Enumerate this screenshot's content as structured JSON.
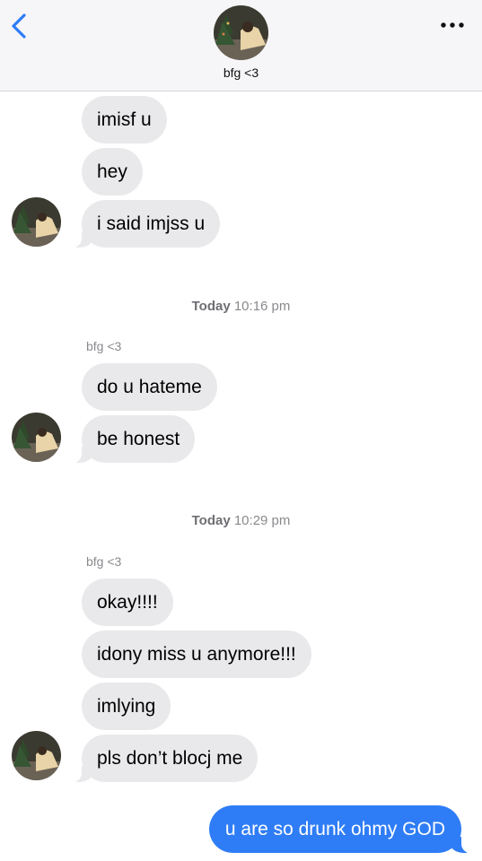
{
  "header": {
    "contact_name": "bfg <3",
    "back_icon": "chevron-left-icon",
    "more_icon": "ellipsis-icon",
    "accent": "#2f7df6"
  },
  "messages": {
    "group1": [
      "imisf u",
      "hey",
      "i said imjss u"
    ],
    "timestamp2": {
      "day": "Today",
      "time": "10:16 pm"
    },
    "sender2": "bfg <3",
    "group2": [
      "do u hateme",
      "be honest"
    ],
    "timestamp3": {
      "day": "Today",
      "time": "10:29 pm"
    },
    "sender3": "bfg <3",
    "group3": [
      "okay!!!!",
      "idony miss u anymore!!!",
      "imlying",
      "pls don’t blocj me"
    ],
    "outgoing": "u are so drunk ohmy GOD"
  },
  "colors": {
    "incoming_bubble": "#e9e9eb",
    "outgoing_bubble": "#2f7df6",
    "header_bg": "#f6f6f8"
  }
}
